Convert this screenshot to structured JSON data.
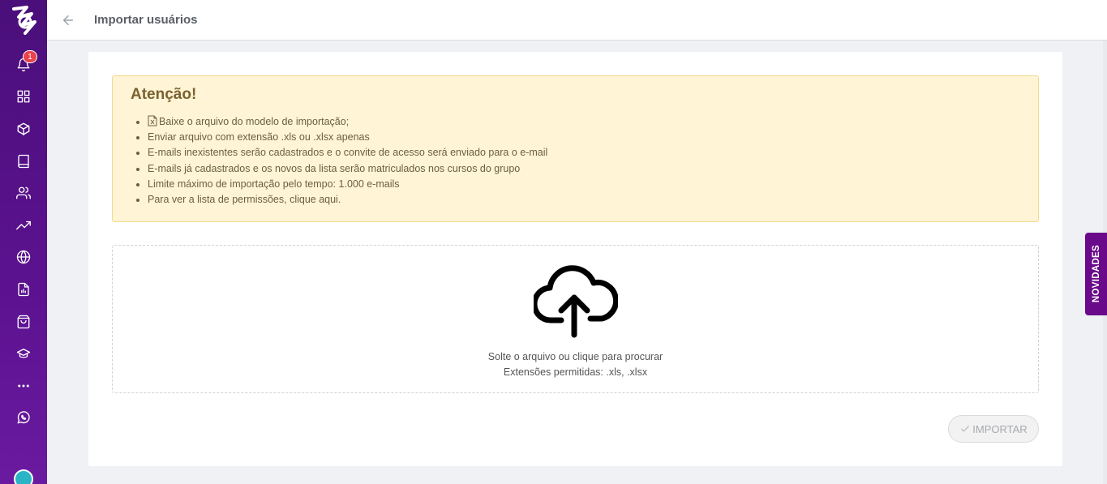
{
  "sidebar": {
    "notification_count": "1",
    "items": [
      {
        "icon": "bell-icon"
      },
      {
        "icon": "grid-icon"
      },
      {
        "icon": "box-icon"
      },
      {
        "icon": "book-icon"
      },
      {
        "icon": "users-icon"
      },
      {
        "icon": "trending-up-icon"
      },
      {
        "icon": "globe-icon"
      },
      {
        "icon": "report-icon"
      },
      {
        "icon": "shopping-bag-icon"
      },
      {
        "icon": "graduation-cap-icon"
      },
      {
        "icon": "more-icon"
      },
      {
        "icon": "whatsapp-icon"
      }
    ]
  },
  "header": {
    "title": "Importar usuários"
  },
  "alert": {
    "title": "Atenção!",
    "items": [
      "Baixe o arquivo do modelo  de importação;",
      "Enviar arquivo com extensão .xls ou .xlsx apenas",
      "E-mails inexistentes serão cadastrados e o convite de acesso será enviado para o e-mail",
      "E-mails já cadastrados e os novos da lista serão matriculados nos cursos do grupo",
      "Limite máximo de importação pelo tempo: 1.000 e-mails",
      "Para ver a lista de permissões,  clique aqui."
    ]
  },
  "dropzone": {
    "text": "Solte o arquivo ou clique para procurar",
    "extensions": "Extensões permitidas: .xls, .xlsx"
  },
  "import_button": {
    "label": "IMPORTAR"
  },
  "novidades": {
    "label": "NOVIDADES"
  },
  "colors": {
    "sidebar": "#5c1290",
    "alert_bg": "#fff4d6",
    "novidades": "#6a0a8a"
  }
}
